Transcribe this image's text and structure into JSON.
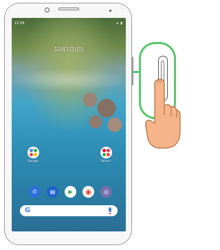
{
  "status_bar": {
    "time": "12:34",
    "indicators": "◂ ▮"
  },
  "lock_screen": {
    "date": "12月1日(日)"
  },
  "folders": [
    {
      "label": "Google"
    },
    {
      "label": "Yahoo!"
    }
  ],
  "dock": {
    "apps": [
      {
        "icon": "phone-icon",
        "color": "#2a6fdb",
        "glyph": "✆"
      },
      {
        "icon": "messages-icon",
        "color": "#1e63c9",
        "glyph": "▤"
      },
      {
        "icon": "play-store-icon",
        "color": "#ffffff",
        "glyph": "▶"
      },
      {
        "icon": "chrome-icon",
        "color": "#ffffff",
        "glyph": "◉"
      },
      {
        "icon": "camera-icon",
        "color": "#7a6fb0",
        "glyph": "◎"
      }
    ]
  },
  "search_bar": {
    "logo": "G"
  },
  "colors": {
    "callout": "#5ac86a",
    "skin": "#f5b48a"
  }
}
